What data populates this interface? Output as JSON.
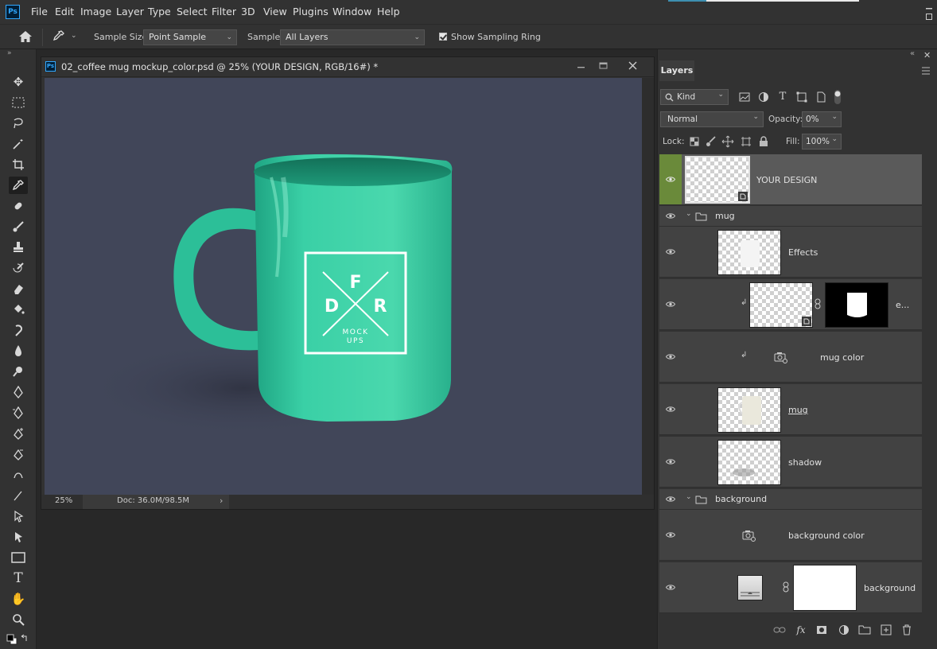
{
  "app": {
    "logo": "Ps"
  },
  "menu": [
    "File",
    "Edit",
    "Image",
    "Layer",
    "Type",
    "Select",
    "Filter",
    "3D",
    "View",
    "Plugins",
    "Window",
    "Help"
  ],
  "options": {
    "sample_size_label": "Sample Size:",
    "sample_size_value": "Point Sample",
    "sample_label": "Sample:",
    "sample_value": "All Layers",
    "show_ring_label": "Show Sampling Ring"
  },
  "document": {
    "title": "02_coffee mug mockup_color.psd @ 25% (YOUR DESIGN, RGB/16#) *",
    "tab_icon": "Ps",
    "zoom": "25%",
    "doc_info": "Doc: 36.0M/98.5M",
    "logo_letters": {
      "top": "F",
      "left": "D",
      "right": "R",
      "line1": "MOCK",
      "line2": "UPS"
    }
  },
  "layers_panel": {
    "tab": "Layers",
    "filter_kind": "Kind",
    "blend_mode": "Normal",
    "opacity_label": "Opacity:",
    "opacity_value": "0%",
    "lock_label": "Lock:",
    "fill_label": "Fill:",
    "fill_value": "100%",
    "layers": [
      {
        "name": "YOUR DESIGN"
      },
      {
        "name": "mug"
      },
      {
        "name": "Effects"
      },
      {
        "name": "e..."
      },
      {
        "name": "mug color"
      },
      {
        "name": "mug"
      },
      {
        "name": "shadow"
      },
      {
        "name": "background"
      },
      {
        "name": "background color"
      },
      {
        "name": "background"
      }
    ]
  },
  "colors": {
    "canvas_bg": "#414659",
    "mug": "#34c9a0",
    "selected_eye": "#6a8a3a"
  }
}
